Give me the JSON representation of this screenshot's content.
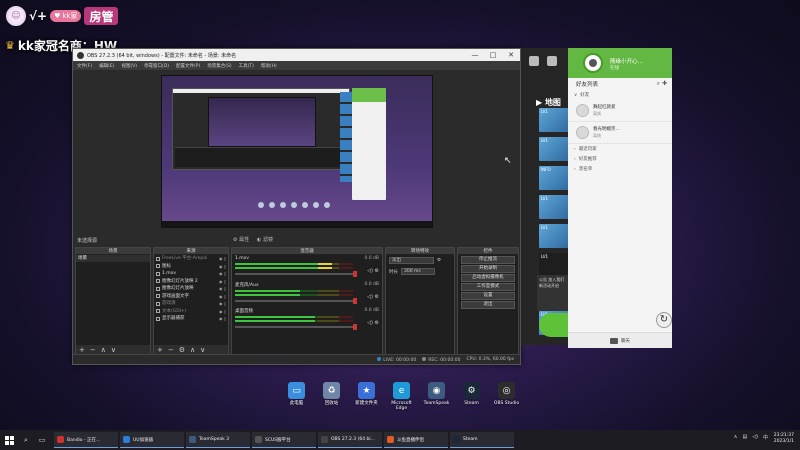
{
  "overlay": {
    "prefix": "√+",
    "tag": "kk家",
    "role": "房管",
    "name": "kk家冠名商：HW"
  },
  "obs": {
    "title": "OBS 27.2.3 (64 bit, windows) - 配置文件: 未命名 - 场景: 未命名",
    "menu": [
      "文件(F)",
      "编辑(E)",
      "视图(V)",
      "停靠窗口(D)",
      "配置文件(P)",
      "场景集合(S)",
      "工具(T)",
      "帮助(H)"
    ],
    "scene_title": "未选择源",
    "toggles": [
      "属性",
      "滤镜"
    ],
    "docks": {
      "scenes": "场景",
      "sources": "来源",
      "mixer": "混音器",
      "transitions": "转场特效",
      "controls": "控件"
    },
    "scenes": [
      "场景"
    ],
    "sources": [
      {
        "label": "FreeLive 平台-Arepai",
        "dim": true
      },
      {
        "label": "图标",
        "dim": false
      },
      {
        "label": "1.mov",
        "dim": false
      },
      {
        "label": "图像幻灯片放映 2",
        "dim": false
      },
      {
        "label": "图像幻灯片放映",
        "dim": false
      },
      {
        "label": "游戏画面文字",
        "dim": false
      },
      {
        "label": "游戏源",
        "dim": true
      },
      {
        "label": "文本(GDI+)",
        "dim": true
      },
      {
        "label": "显示器捕获",
        "dim": false
      }
    ],
    "mixer": [
      {
        "name": "1.mov",
        "db": "0.0 dB",
        "level": 0.82
      },
      {
        "name": "麦克风/Aux",
        "db": "0.0 dB",
        "level": 0.55
      },
      {
        "name": "桌面音频",
        "db": "0.0 dB",
        "level": 0.68
      }
    ],
    "transition": {
      "value": "淡出",
      "duration_label": "时长",
      "duration": "300 ms"
    },
    "controls": [
      "停止推流",
      "开始录制",
      "启动虚拟摄像机",
      "工作室模式",
      "设置",
      "退出"
    ],
    "status": {
      "live": "LIVE: 00:00:00",
      "rec": "REC: 00:00:00",
      "cpu": "CPU: 0.3%, 60.00 fps"
    }
  },
  "launcher": {
    "map_label": "地图",
    "tiles": [
      "LV1",
      "LV1",
      "INFO",
      "LV1",
      "LV1",
      "LV1",
      "LV1",
      "LV1"
    ],
    "news": "公告 加入我们 新活动开启"
  },
  "friends": {
    "self_name": "随缘小开心…",
    "self_status": "在线",
    "header": "好友列表",
    "groups": [
      {
        "label": "好友",
        "count": ""
      },
      {
        "label": "最近玩家",
        "count": ""
      },
      {
        "label": "好友推荐",
        "count": ""
      },
      {
        "label": "黑名单",
        "count": ""
      }
    ],
    "list": [
      {
        "name": "舞起红颜爱",
        "status": "离线"
      },
      {
        "name": "春光明媚笑...",
        "status": "离线"
      }
    ],
    "footer": "聊天"
  },
  "desktop_icons": [
    {
      "label": "此电脑",
      "color": "#3b8ede",
      "glyph": "▭"
    },
    {
      "label": "回收站",
      "color": "#6f86a8",
      "glyph": "♻"
    },
    {
      "label": "新建文件夹",
      "color": "#3b6fd8",
      "glyph": "★"
    },
    {
      "label": "Microsoft Edge",
      "color": "#1f9ad6",
      "glyph": "e"
    },
    {
      "label": "TeamSpeak",
      "color": "#3d5a80",
      "glyph": "◉"
    },
    {
      "label": "Steam",
      "color": "#1b2838",
      "glyph": "⚙"
    },
    {
      "label": "OBS Studio",
      "color": "#2d2d2d",
      "glyph": "◎"
    }
  ],
  "taskbar": {
    "apps": [
      {
        "label": "Bandio - 正在...",
        "color": "#d03030"
      },
      {
        "label": "UU加速器",
        "color": "#2b7fd4"
      },
      {
        "label": "TeamSpeak 3",
        "color": "#3d5a80"
      },
      {
        "label": "SCUS服平台",
        "color": "#555555"
      },
      {
        "label": "OBS 27.2.3 (64 bi...",
        "color": "#444444"
      },
      {
        "label": "斗鱼直播伴侣",
        "color": "#e05a2a"
      },
      {
        "label": "Steam",
        "color": "#1b2838"
      }
    ],
    "clock_time": "23:21:37",
    "clock_date": "2023/1/1"
  }
}
